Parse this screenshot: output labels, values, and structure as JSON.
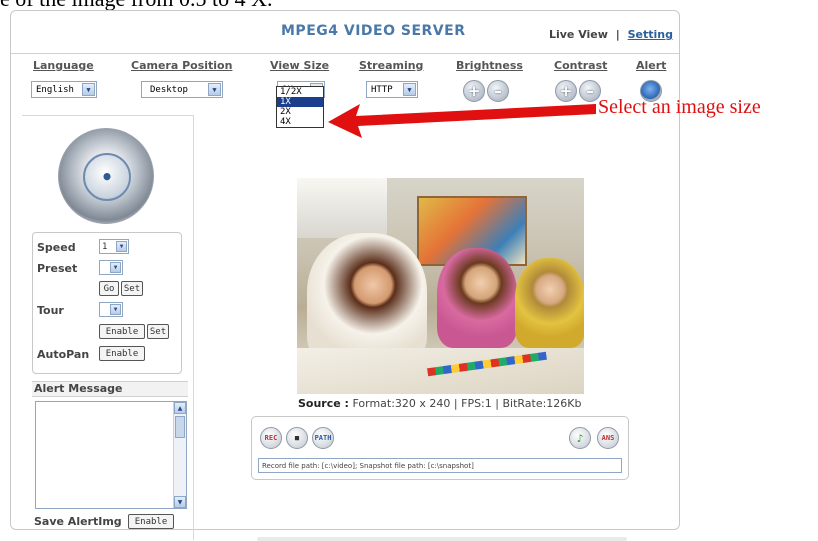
{
  "caption_fragment": "e of the image from 0.5 to 4 X.",
  "app_title": "MPEG4 VIDEO SERVER",
  "top_links": {
    "live_view": "Live View",
    "separator": "|",
    "setting": "Setting"
  },
  "controls": {
    "language": {
      "label": "Language",
      "value": "English"
    },
    "camera_position": {
      "label": "Camera Position",
      "value": "Desktop"
    },
    "view_size": {
      "label": "View Size",
      "value": "1X",
      "options": [
        "1/2X",
        "1X",
        "2X",
        "4X"
      ],
      "selected_index": 1
    },
    "streaming": {
      "label": "Streaming",
      "value": "HTTP"
    },
    "brightness": {
      "label": "Brightness",
      "plus": "+",
      "minus": "–"
    },
    "contrast": {
      "label": "Contrast",
      "plus": "+",
      "minus": "–"
    },
    "alert": {
      "label": "Alert"
    }
  },
  "annotation": "Select an image size",
  "ptz": {
    "speed_label": "Speed",
    "speed_value": "1",
    "preset_label": "Preset",
    "preset_value": "",
    "go": "Go",
    "set": "Set",
    "tour_label": "Tour",
    "tour_value": "",
    "enable": "Enable",
    "set2": "Set",
    "autopan_label": "AutoPan",
    "autopan_enable": "Enable"
  },
  "alert_message": {
    "title": "Alert Message",
    "text": ""
  },
  "save_alertimg": {
    "label": "Save AlertImg",
    "button": "Enable"
  },
  "source": {
    "label": "Source :",
    "text": "Format:320 x 240 | FPS:1 | BitRate:126Kb"
  },
  "bottom": {
    "rec": "REC",
    "path": "PATH",
    "ans": "ANS",
    "path_text": "Record file path: [c:\\video]; Snapshot file path: [c:\\snapshot]"
  }
}
